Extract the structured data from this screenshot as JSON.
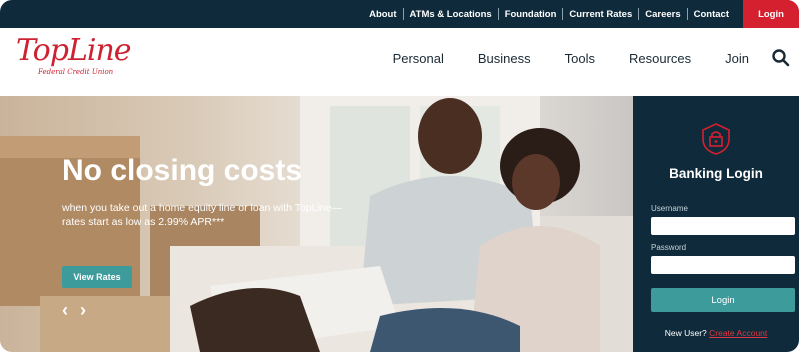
{
  "utility_nav": {
    "links": [
      "About",
      "ATMs & Locations",
      "Foundation",
      "Current Rates",
      "Careers",
      "Contact"
    ],
    "login_label": "Login"
  },
  "brand": {
    "name": "TopLine",
    "tagline": "Federal Credit Union",
    "color": "#cc2231"
  },
  "main_nav": {
    "items": [
      "Personal",
      "Business",
      "Tools",
      "Resources",
      "Join"
    ],
    "search_icon": "search-icon"
  },
  "hero": {
    "headline": "No closing costs",
    "subtext": "when you take out a home equity line or loan with TopLine—rates start as low as 2.99% APR***",
    "cta_label": "View Rates",
    "prev_arrow": "‹",
    "next_arrow": "›"
  },
  "login_panel": {
    "icon": "shield-lock-icon",
    "title": "Banking Login",
    "username_label": "Username",
    "password_label": "Password",
    "submit_label": "Login",
    "new_user_text": "New User?",
    "create_account_label": "Create Account"
  },
  "colors": {
    "navy": "#0f2a3a",
    "red": "#d5202f",
    "teal": "#3d9b9b"
  }
}
